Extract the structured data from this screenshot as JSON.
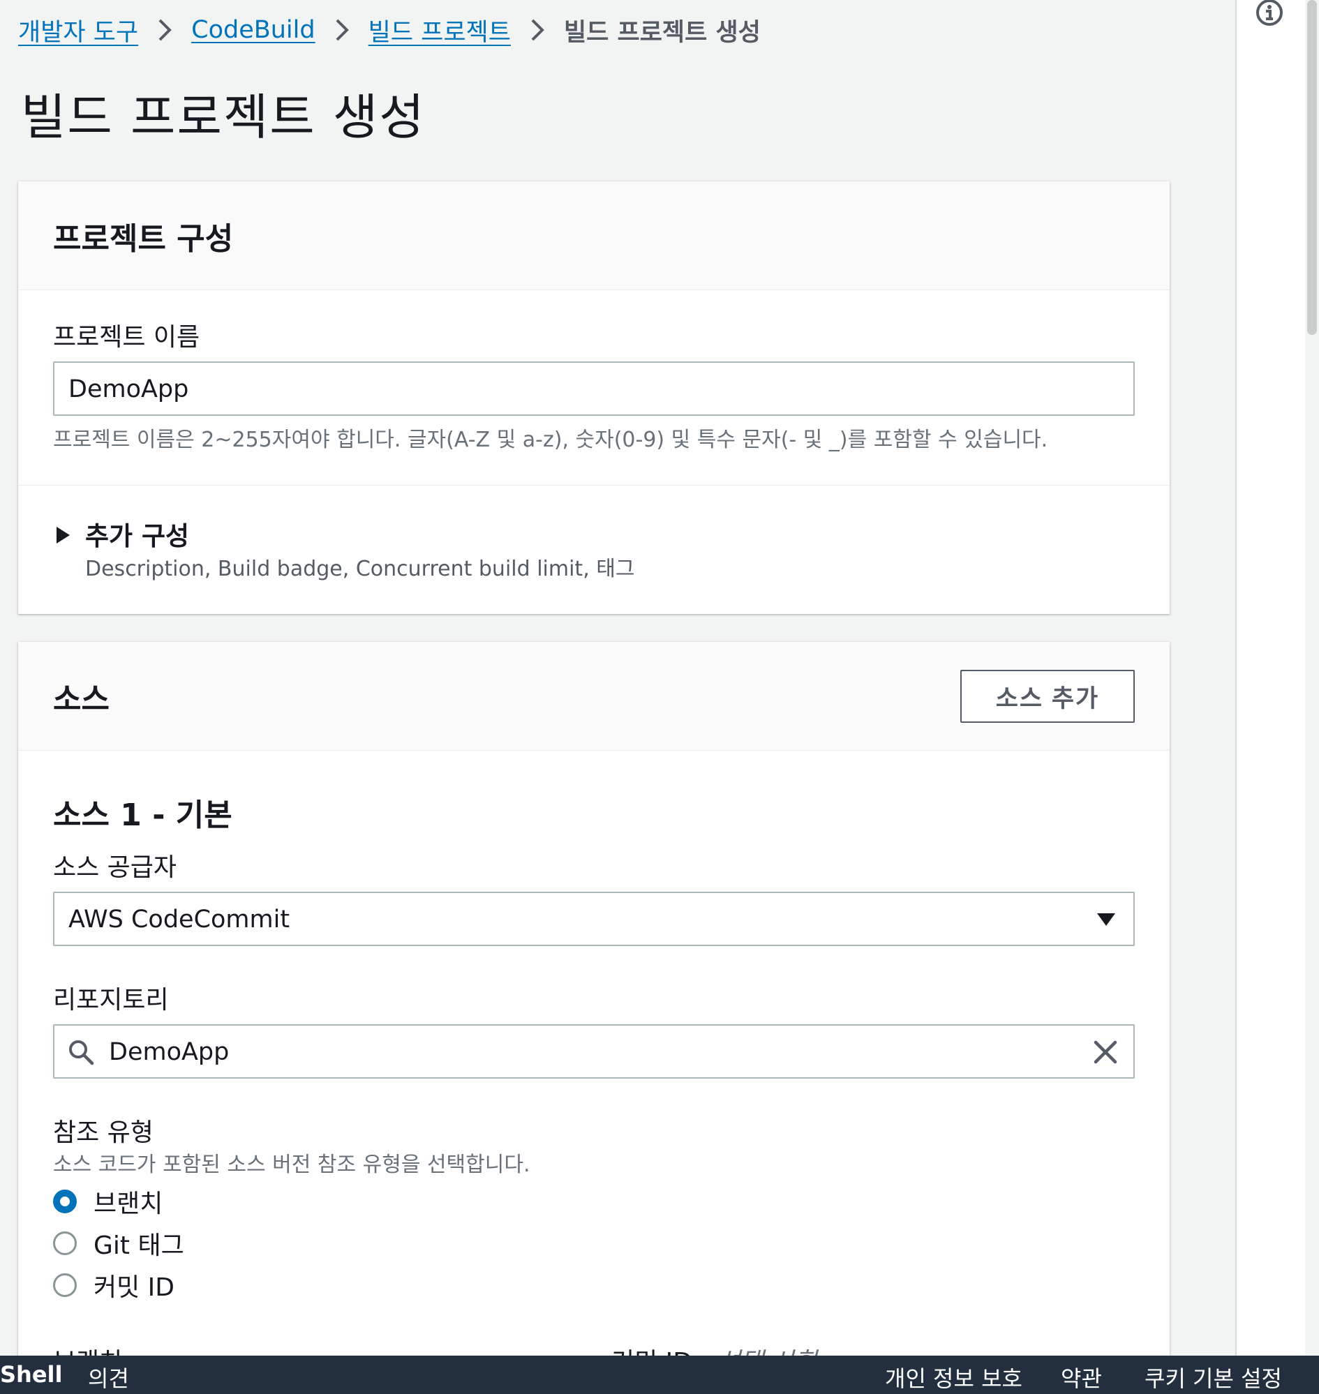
{
  "breadcrumb": {
    "items": [
      "개발자 도구",
      "CodeBuild",
      "빌드 프로젝트"
    ],
    "current": "빌드 프로젝트 생성"
  },
  "page": {
    "title": "빌드 프로젝트 생성"
  },
  "project_config": {
    "title": "프로젝트 구성",
    "name_label": "프로젝트 이름",
    "name_value": "DemoApp",
    "name_hint": "프로젝트 이름은 2~255자여야 합니다. 글자(A-Z 및 a-z), 숫자(0-9) 및 특수 문자(- 및 _)를 포함할 수 있습니다.",
    "additional": {
      "title": "추가 구성",
      "description": "Description, Build badge, Concurrent build limit, 태그"
    }
  },
  "source": {
    "title": "소스",
    "add_button": "소스 추가",
    "primary_title": "소스 1 - 기본",
    "provider_label": "소스 공급자",
    "provider_value": "AWS CodeCommit",
    "repo_label": "리포지토리",
    "repo_value": "DemoApp",
    "ref_type_label": "참조 유형",
    "ref_type_hint": "소스 코드가 포함된 소스 버전 참조 유형을 선택합니다.",
    "ref_options": [
      {
        "label": "브랜치",
        "checked": true
      },
      {
        "label": "Git 태그",
        "checked": false
      },
      {
        "label": "커밋 ID",
        "checked": false
      }
    ],
    "branch_label": "브랜치",
    "commit_label": "커밋 ID",
    "commit_optional": "선택 사항"
  },
  "footer": {
    "left": [
      "Shell",
      "의견"
    ],
    "right": [
      "개인 정보 보호",
      "약관",
      "쿠키 기본 설정"
    ]
  },
  "colors": {
    "link": "#0073bb",
    "footer_bg": "#232f3e",
    "page_bg": "#f2f3f3"
  }
}
